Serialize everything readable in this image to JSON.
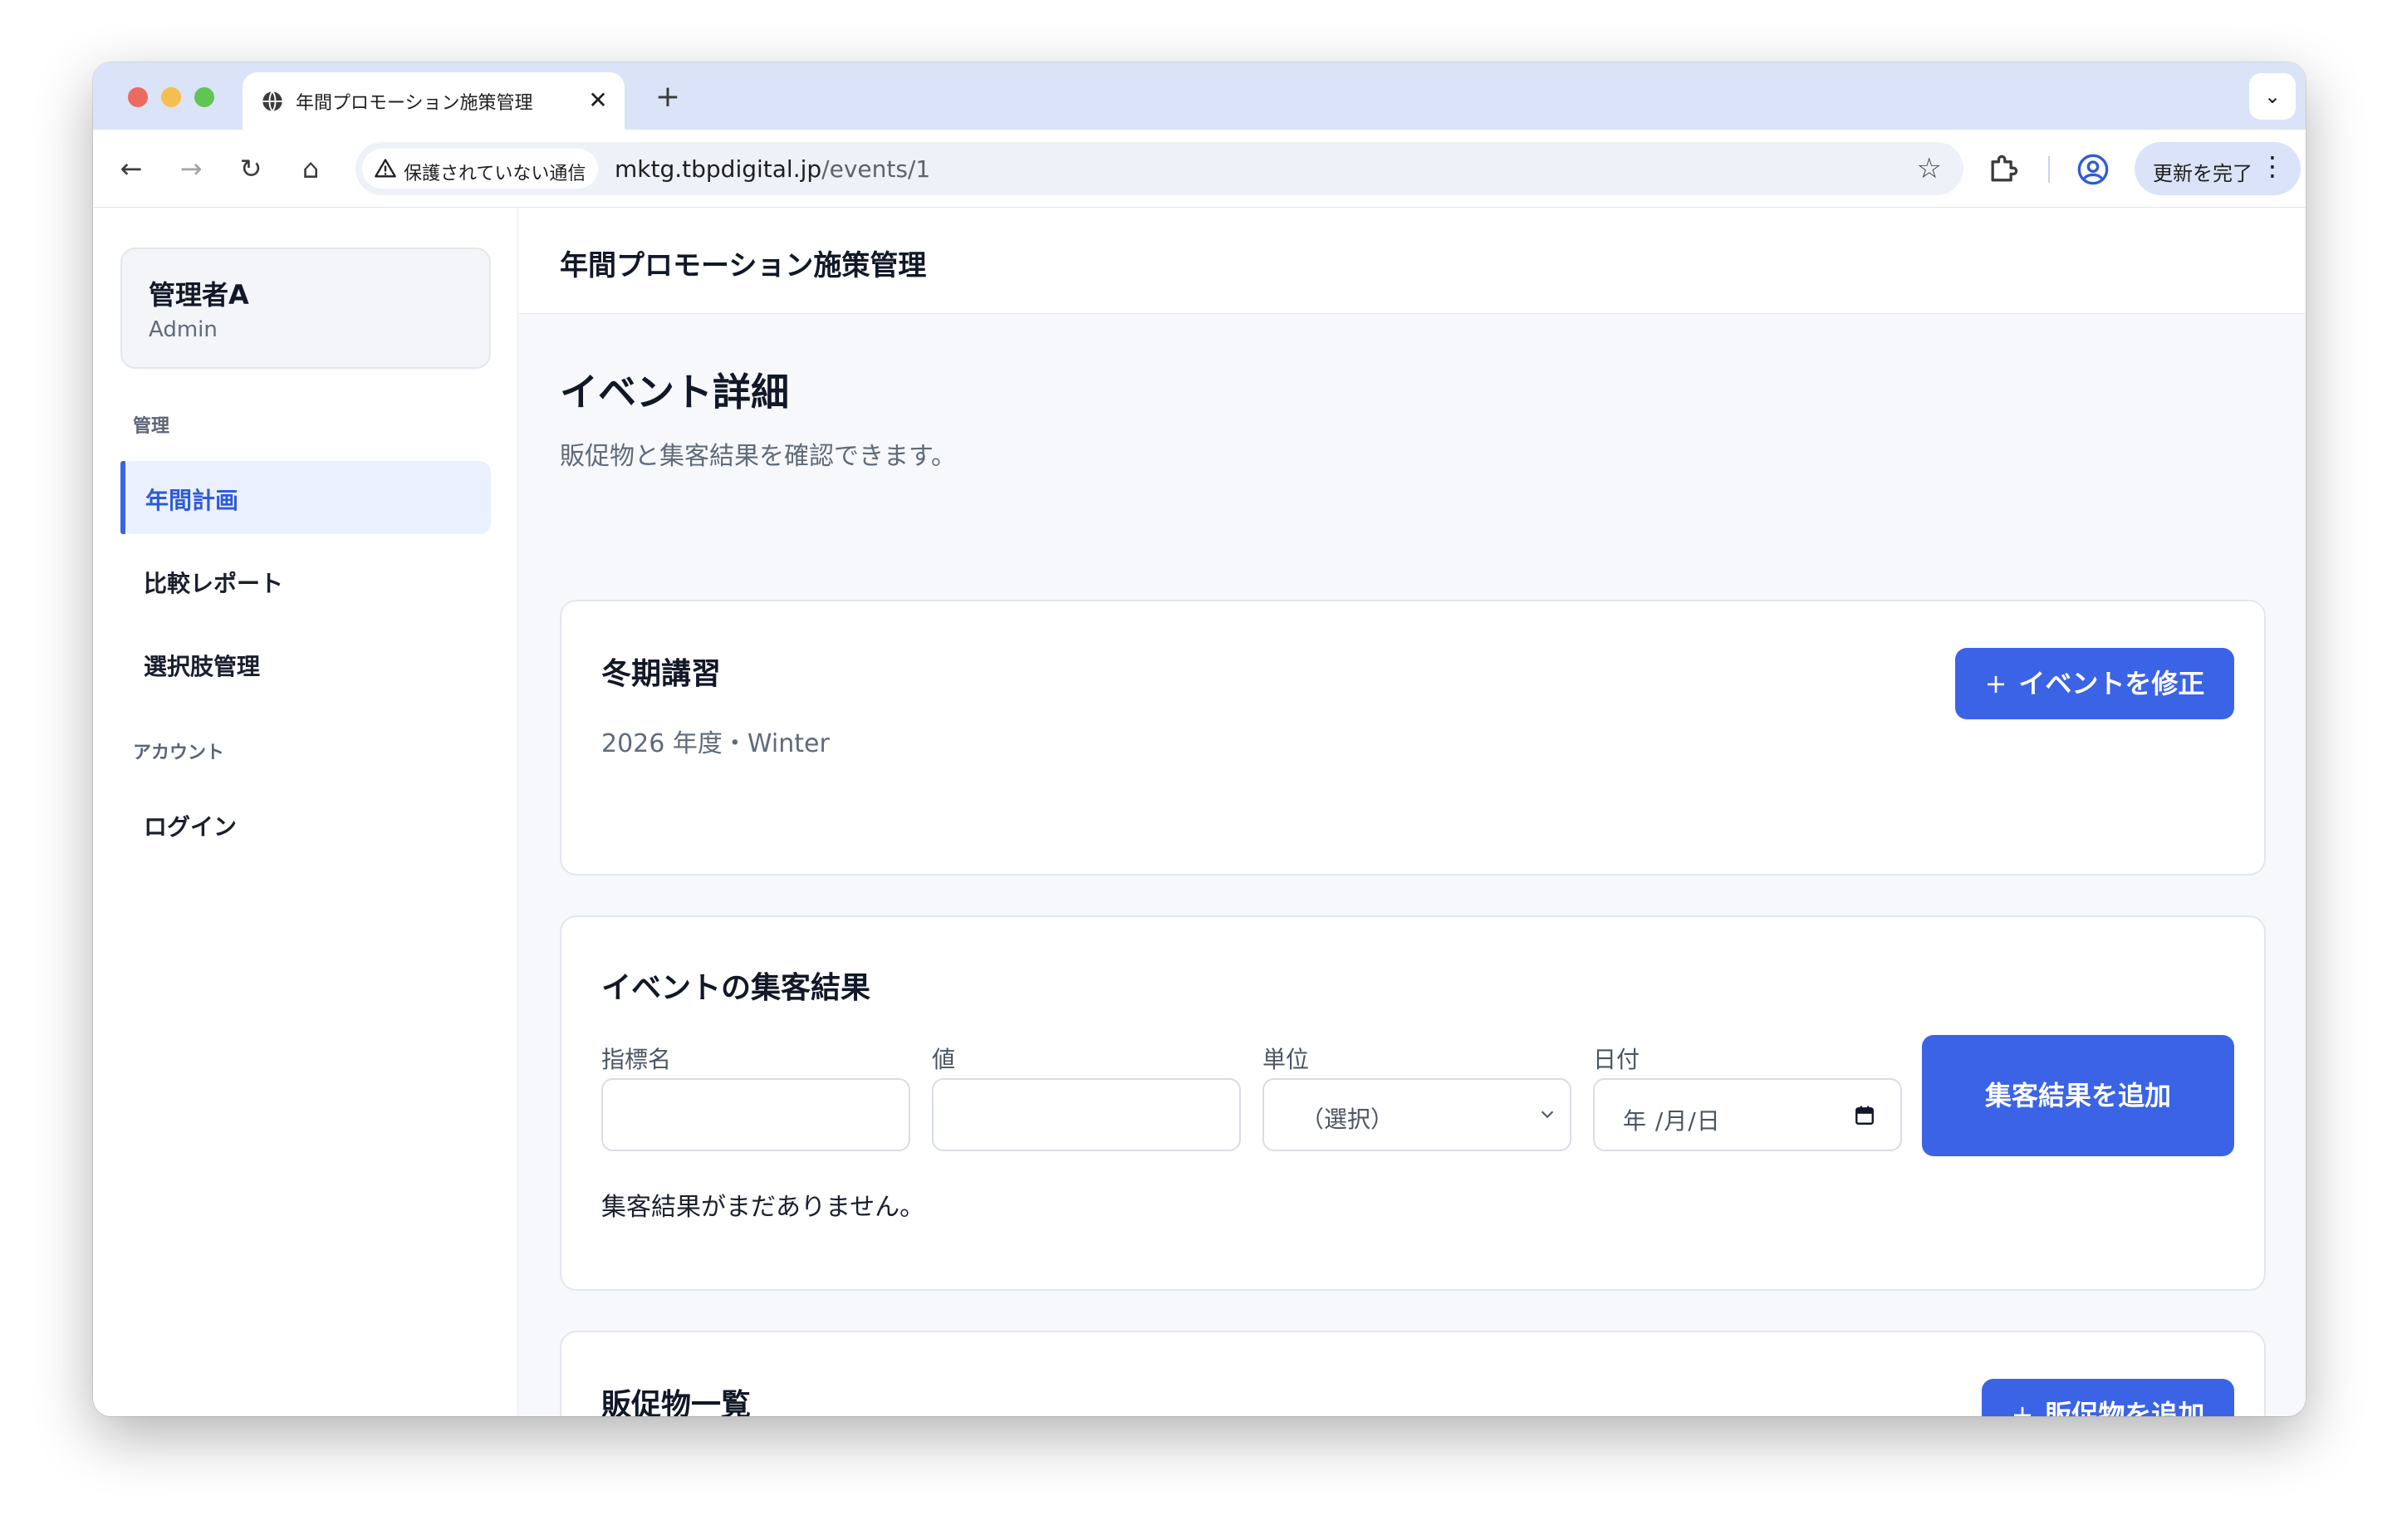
{
  "browser": {
    "colors": {
      "close": "#ed6a5e",
      "minimize": "#f5bf4f",
      "maximize": "#61c554"
    },
    "tab": {
      "title": "年間プロモーション施策管理",
      "close_glyph": "✕"
    },
    "new_tab_glyph": "+",
    "tab_menu_glyph": "⌄",
    "nav": {
      "back_glyph": "←",
      "forward_glyph": "→",
      "reload_glyph": "↻",
      "home_glyph": "⌂"
    },
    "security_chip": "保護されていない通信",
    "url_host": "mktg.tbpdigital.jp",
    "url_path": "/events/1",
    "bookmark_glyph": "☆",
    "update_button": "更新を完了",
    "menu_glyph": "⋮"
  },
  "sidebar": {
    "user": {
      "name": "管理者A",
      "role": "Admin"
    },
    "sections": [
      {
        "title": "管理",
        "items": [
          {
            "label": "年間計画",
            "active": true
          },
          {
            "label": "比較レポート"
          },
          {
            "label": "選択肢管理"
          }
        ]
      },
      {
        "title": "アカウント",
        "items": [
          {
            "label": "ログイン"
          }
        ]
      }
    ]
  },
  "header": {
    "app_title": "年間プロモーション施策管理"
  },
  "page": {
    "title": "イベント詳細",
    "subtitle": "販促物と集客結果を確認できます。"
  },
  "event_card": {
    "name": "冬期講習",
    "meta": "2026 年度・Winter",
    "edit_button": "イベントを修正",
    "plus_glyph": "+"
  },
  "results_card": {
    "title": "イベントの集客結果",
    "fields": {
      "metric_label": "指標名",
      "metric_value": "",
      "value_label": "値",
      "value_value": "",
      "unit_label": "単位",
      "unit_selected": "（選択）",
      "date_label": "日付",
      "date_placeholder": "年 /月/日"
    },
    "add_button": "集客結果を追加",
    "empty_message": "集客結果がまだありません。"
  },
  "materials_card": {
    "title": "販促物一覧",
    "add_button": "販促物を追加",
    "plus_glyph": "+"
  },
  "theme": {
    "accent": "#3b63e6",
    "active_bg": "#eaf0fd"
  }
}
